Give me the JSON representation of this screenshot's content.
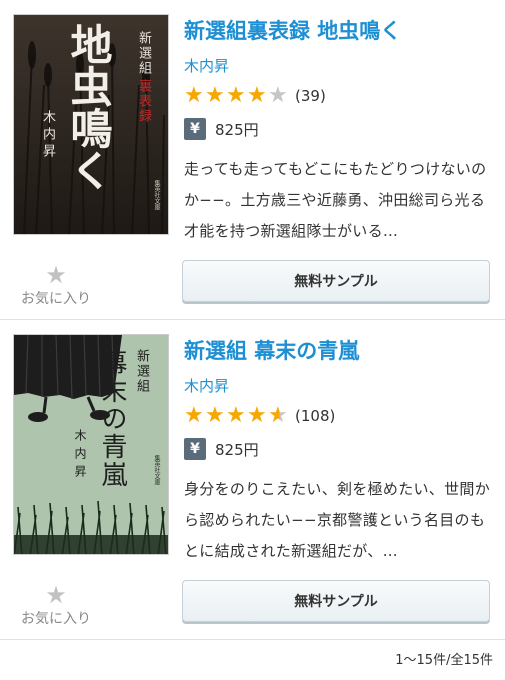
{
  "books": [
    {
      "title": "新選組裏表録 地虫鳴く",
      "author": "木内昇",
      "rating": 4,
      "rating_count": "(39)",
      "price": "825円",
      "description": "走っても走ってもどこにもたどりつけないのか−−。土方歳三や近藤勇、沖田総司ら光る才能を持つ新選組隊士がいる…",
      "sample_label": "無料サンプル",
      "favorite_label": "お気に入り",
      "cover": {
        "big_title": "地虫鳴く",
        "series": "新選組",
        "series_red": "裏表録",
        "author": "木内昇",
        "publisher": "集英社文庫"
      }
    },
    {
      "title": "新選組 幕末の青嵐",
      "author": "木内昇",
      "rating": 4.5,
      "rating_count": "(108)",
      "price": "825円",
      "description": "身分をのりこえたい、剣を極めたい、世間から認められたい−−京都警護という名目のもとに結成された新選組だが、…",
      "sample_label": "無料サンプル",
      "favorite_label": "お気に入り",
      "cover": {
        "big_title": "幕末の青嵐",
        "series": "新選組",
        "author": "木内昇",
        "publisher": "集英社文庫"
      }
    }
  ],
  "pager": "1〜15件/全15件",
  "colors": {
    "link": "#1f8fd3",
    "star": "#f6a800",
    "yen_badge": "#5a6b7a"
  }
}
